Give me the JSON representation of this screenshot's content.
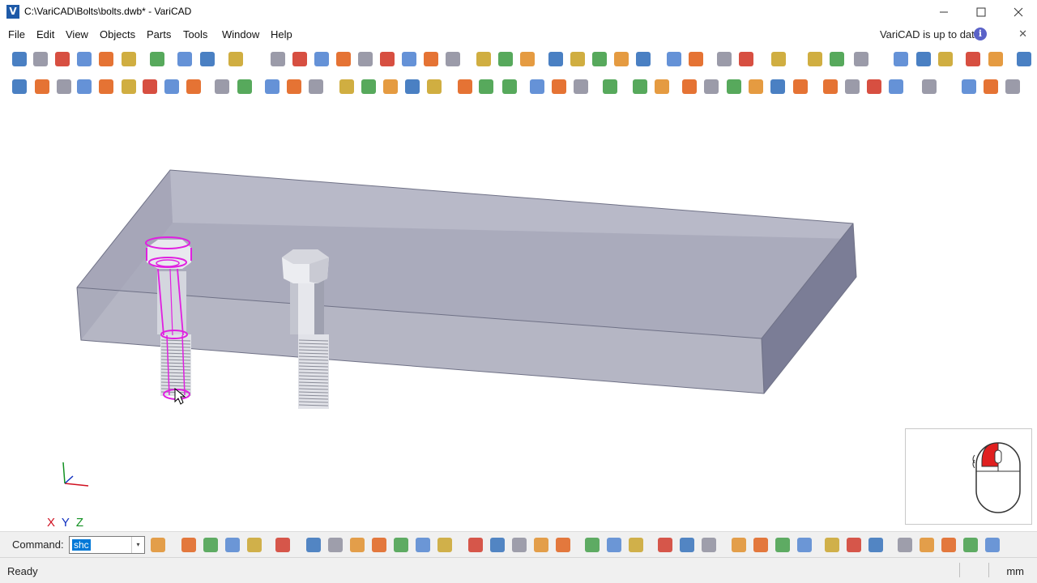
{
  "window": {
    "title": "C:\\VariCAD\\Bolts\\bolts.dwb* - VariCAD",
    "minimize_icon": "minimize-icon",
    "maximize_icon": "maximize-icon",
    "close_icon": "close-icon"
  },
  "menu": {
    "items": [
      "File",
      "Edit",
      "View",
      "Objects",
      "Parts",
      "Tools",
      "Window",
      "Help"
    ],
    "update_note": "VariCAD is up to date",
    "info_glyph": "i",
    "close_glyph": "✕"
  },
  "viewport": {
    "axes_label": {
      "x": "X",
      "y": "Y",
      "z": "Z"
    },
    "colors": {
      "plate": "#8c8ea8",
      "selection": "#e020e0",
      "bolt": "#e4e6ec"
    }
  },
  "command": {
    "label": "Command:",
    "value": "shc",
    "dropdown_glyph": "▾"
  },
  "status": {
    "text": "Ready",
    "unit": "mm"
  }
}
